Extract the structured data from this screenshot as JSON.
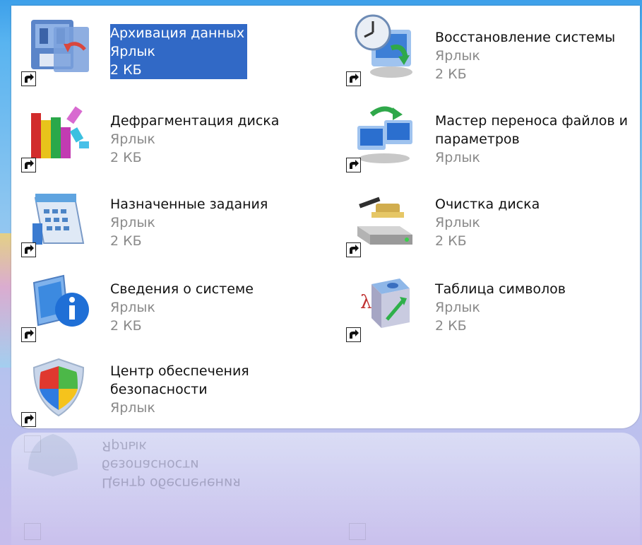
{
  "items": [
    {
      "name": "Архивация данных",
      "type": "Ярлык",
      "size": "2 КБ",
      "icon": "backup-icon",
      "selected": true
    },
    {
      "name": "Восстановление системы",
      "type": "Ярлык",
      "size": "2 КБ",
      "icon": "system-restore-icon"
    },
    {
      "name": "Дефрагментация диска",
      "type": "Ярлык",
      "size": "2 КБ",
      "icon": "defrag-icon"
    },
    {
      "name": "Мастер переноса файлов и",
      "name2": "параметров",
      "type": "Ярлык",
      "icon": "transfer-wizard-icon"
    },
    {
      "name": "Назначенные задания",
      "type": "Ярлык",
      "size": "2 КБ",
      "icon": "scheduled-tasks-icon"
    },
    {
      "name": "Очистка диска",
      "type": "Ярлык",
      "size": "2 КБ",
      "icon": "disk-cleanup-icon"
    },
    {
      "name": "Сведения о системе",
      "type": "Ярлык",
      "size": "2 КБ",
      "icon": "system-info-icon"
    },
    {
      "name": "Таблица символов",
      "type": "Ярлык",
      "size": "2 КБ",
      "icon": "character-map-icon"
    },
    {
      "name": "Центр обеспечения",
      "name2": "безопасности",
      "type": "Ярлык",
      "icon": "security-center-icon"
    }
  ],
  "reflection": {
    "line1": "Ярлык",
    "line2": "безопасности",
    "line3": "Центр обеспечения"
  },
  "colors": {
    "selection": "#3169c6",
    "secondary_text": "#8a8a8a"
  }
}
